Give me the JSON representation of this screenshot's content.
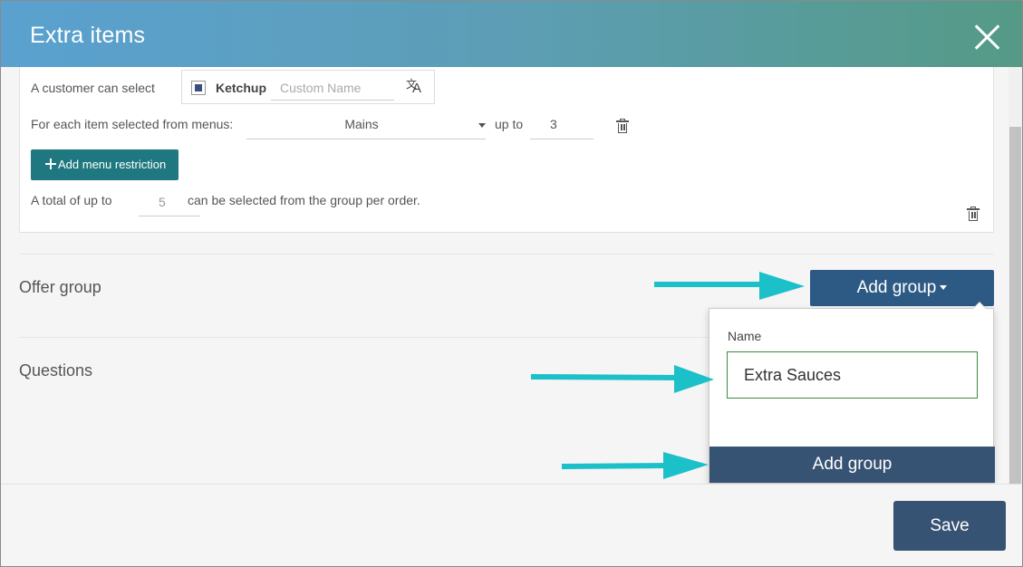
{
  "modal": {
    "title": "Extra items"
  },
  "restriction": {
    "customer_can_select_label": "A customer can select",
    "item_name": "Ketchup",
    "custom_name_placeholder": "Custom Name",
    "custom_name_value": "",
    "for_each_label": "For each item selected from menus:",
    "menu_selected": "Mains",
    "up_to_label": "up to",
    "up_to_value": "3",
    "add_menu_restriction_label": "Add menu restriction",
    "total_prefix": "A total of up to",
    "total_value": "5",
    "total_suffix": "can be selected from the group per order."
  },
  "sections": {
    "offer_group_title": "Offer group",
    "questions_title": "Questions",
    "add_group_button_label": "Add group"
  },
  "dropdown": {
    "name_label": "Name",
    "name_value": "Extra Sauces",
    "submit_label": "Add group"
  },
  "footer": {
    "save_label": "Save"
  },
  "icons": {
    "close": "close-icon",
    "translate": "translate-icon",
    "trash": "trash-icon",
    "plus": "plus-icon",
    "caret": "caret-down-icon",
    "arrow": "arrow-right-icon"
  },
  "colors": {
    "header_gradient_start": "#5aa1d0",
    "header_gradient_end": "#559a86",
    "teal_button": "#1f7880",
    "primary_button": "#2c5a85",
    "dark_button": "#375373",
    "annotation_arrow": "#1cc0c8"
  }
}
